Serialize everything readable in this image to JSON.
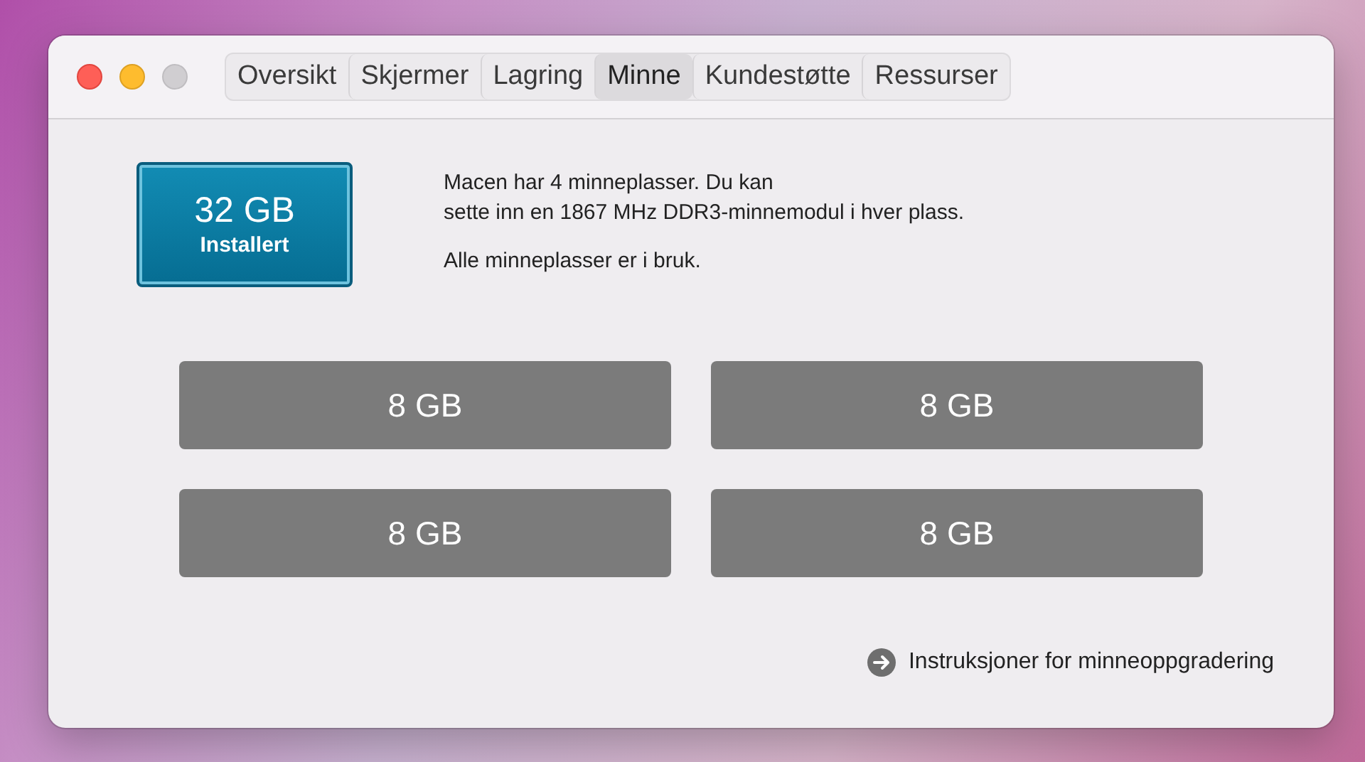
{
  "window_controls": [
    {
      "kind": "close",
      "disabled": false
    },
    {
      "kind": "minimize",
      "disabled": false
    },
    {
      "kind": "zoom",
      "disabled": true
    }
  ],
  "tabs": [
    {
      "label": "Oversikt",
      "selected": false
    },
    {
      "label": "Skjermer",
      "selected": false
    },
    {
      "label": "Lagring",
      "selected": false
    },
    {
      "label": "Minne",
      "selected": true
    },
    {
      "label": "Kundestøtte",
      "selected": false
    },
    {
      "label": "Ressurser",
      "selected": false
    }
  ],
  "memory": {
    "total": "32 GB",
    "caption": "Installert"
  },
  "description_lines": [
    "Macen har 4 minneplasser. Du kan",
    "sette inn en 1867 MHz DDR3-minnemodul i hver plass."
  ],
  "status": "Alle minneplasser er i bruk.",
  "slots": [
    {
      "size": "8 GB"
    },
    {
      "size": "8 GB"
    },
    {
      "size": "8 GB"
    },
    {
      "size": "8 GB"
    }
  ],
  "link": "Instruksjoner for minneoppgradering"
}
